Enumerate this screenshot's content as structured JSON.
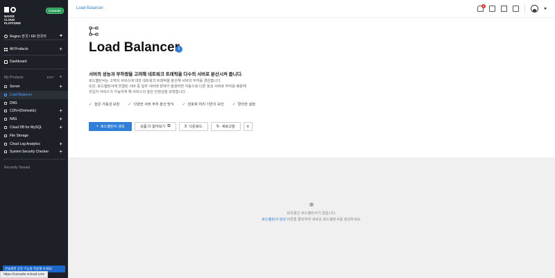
{
  "brand": {
    "line1": "NAVER",
    "line2": "CLOUD PLATFORM",
    "console_badge": "Console"
  },
  "region": {
    "label": "Region 한국 / KR 한국어"
  },
  "sidebar": {
    "all_products": "All Products",
    "dashboard": "Dashboard",
    "my_products": "My Products",
    "edit": "EDIT",
    "items": [
      {
        "label": "Server",
        "expandable": true
      },
      {
        "label": "Load Balancer",
        "expandable": false,
        "active": true
      },
      {
        "label": "DNS",
        "expandable": false
      },
      {
        "label": "CDN+(Domestic)",
        "expandable": true
      },
      {
        "label": "NAS",
        "expandable": true
      },
      {
        "label": "Cloud DB for MySQL",
        "expandable": true
      },
      {
        "label": "File Storage",
        "expandable": false
      },
      {
        "label": "Cloud Log Analytics",
        "expandable": true
      },
      {
        "label": "System Security Checker",
        "expandable": true
      }
    ],
    "recently_viewed": "Recently Viewed",
    "bottom_banner": "콘솔화면 공유 기능을 적용해 보세요!"
  },
  "header": {
    "breadcrumb": "Load Balancer",
    "notification_count": "4"
  },
  "hero": {
    "title": "Load Balancer",
    "info": "i",
    "headline": "서버의 성능과 부하량을 고려해 네트워크 트래픽을 다수의 서버로 분산시켜 줍니다.",
    "desc_lines": [
      "로드밸런서는 고객의 서비스에 대한 네트워크 트래픽을 분산해 서버의 부하를 경감합니다.",
      "또한, 로드밸런서에 연결된 서버 중 일부 서버에 장애가 발생하면 자동으로 다른 정상 서버로 부하를 배분해",
      "유입지 서비스가 가능하게 해 서비스의 높은 안정성을 보장합니다."
    ],
    "features": [
      "높은 가용성 보장",
      "다양한 서버 부하 분산 방식",
      "암호화 처리 기반의 보안",
      "편리한 설정"
    ]
  },
  "actions": {
    "create": "로드밸런서 생성",
    "learn_more": "상품 더 알아보기",
    "download": "다운로드",
    "refresh": "새로고침"
  },
  "empty_state": {
    "line1": "보유중인 로드밸런서가 없습니다.",
    "link": "로드밸런서 생성",
    "line2_rest": " 버튼을 클릭하여 새로운 로드밸런서를 생성하세요."
  },
  "status_bar": {
    "url": "https://console.ncloud.com"
  },
  "colors": {
    "accent": "#2f7fd8",
    "sidebar_bg": "#1d2026",
    "console_badge": "#1f9d55"
  }
}
